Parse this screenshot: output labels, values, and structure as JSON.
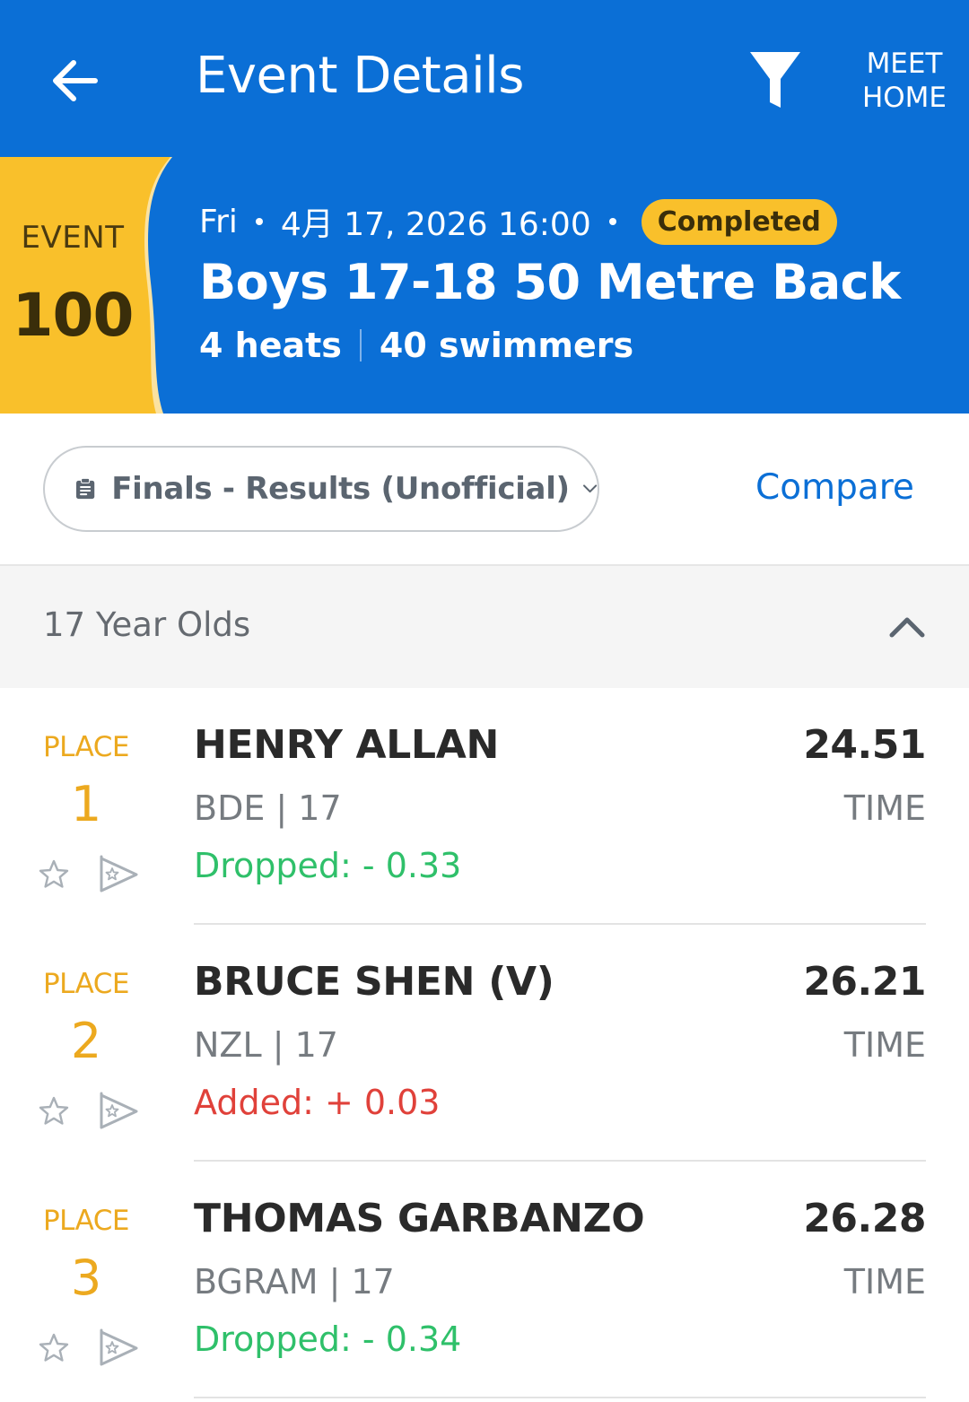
{
  "appbar": {
    "title": "Event Details",
    "back_icon": "arrow-left-icon",
    "filter_icon": "filter-icon",
    "meet_home_line1": "MEET",
    "meet_home_line2": "HOME",
    "color": "#0b6fd6"
  },
  "event": {
    "label": "EVENT",
    "number": "100",
    "day": "Fri",
    "date_time": "4月 17, 2026 16:00",
    "status": "Completed",
    "title": "Boys 17-18 50 Metre Back",
    "heats": "4 heats",
    "swimmers": "40 swimmers",
    "tab_color": "#f9c02b"
  },
  "selector": {
    "dropdown_icon": "clipboard-icon",
    "dropdown_value": "Finals - Results (Unofficial)",
    "compare_label": "Compare"
  },
  "group": {
    "title": "17 Year Olds",
    "expanded": true,
    "toggle_icon": "chevron-up-icon"
  },
  "results": [
    {
      "place_label": "PLACE",
      "place": "1",
      "name": "HENRY ALLAN",
      "info": "BDE | 17",
      "delta": "Dropped: - 0.33",
      "delta_type": "dropped",
      "time": "24.51",
      "time_label": "TIME"
    },
    {
      "place_label": "PLACE",
      "place": "2",
      "name": "BRUCE SHEN (V)",
      "info": "NZL | 17",
      "delta": "Added: + 0.03",
      "delta_type": "added",
      "time": "26.21",
      "time_label": "TIME"
    },
    {
      "place_label": "PLACE",
      "place": "3",
      "name": "THOMAS GARBANZO",
      "info": "BGRAM | 17",
      "delta": "Dropped: - 0.34",
      "delta_type": "dropped",
      "time": "26.28",
      "time_label": "TIME"
    }
  ],
  "colors": {
    "place": "#eca91f",
    "dropped": "#2fc06a",
    "added": "#e0413a",
    "link": "#0b6fd6"
  }
}
